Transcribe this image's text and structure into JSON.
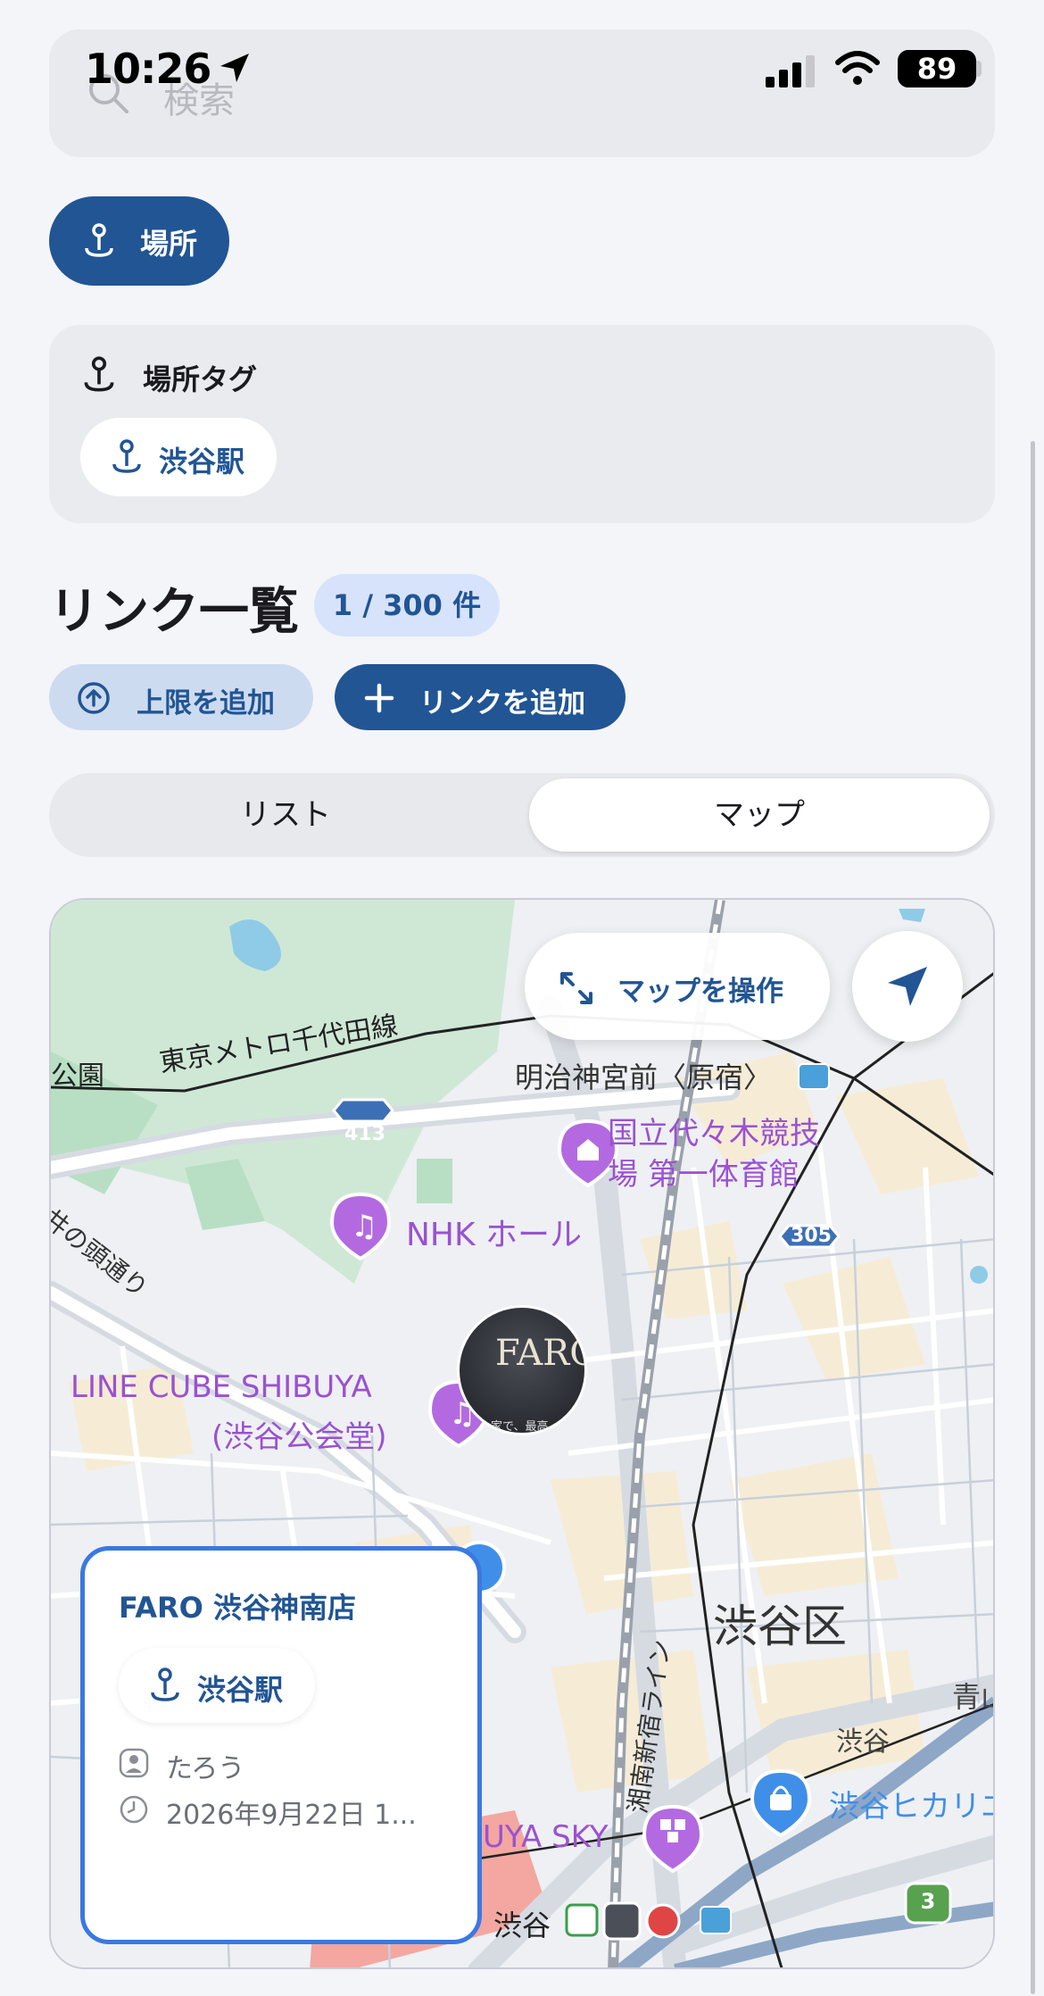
{
  "status_bar": {
    "time": "10:26",
    "battery": "89"
  },
  "search": {
    "placeholder": "検索"
  },
  "location_chip": {
    "label": "場所"
  },
  "tags_card": {
    "title": "場所タグ",
    "tag": "渋谷駅"
  },
  "links": {
    "title": "リンク一覧",
    "count": "1 / 300 件",
    "add_limit_label": "上限を追加",
    "add_link_label": "リンクを追加"
  },
  "segmented": {
    "list_label": "リスト",
    "map_label": "マップ",
    "selected": "マップ"
  },
  "map": {
    "operate_label": "マップを操作",
    "labels": {
      "park": "公園",
      "chiyoda_line": "東京メトロ千代田線",
      "route_413": "413",
      "route_305": "305",
      "ikenohata": "井の頭通り",
      "meiji_station": "明治神宮前〈原宿〉",
      "gymnasium_line1": "国立代々木競技",
      "gymnasium_line2": "場 第一体育館",
      "nhk_hall": "NHK ホール",
      "line_cube_line1": "LINE CUBE SHIBUYA",
      "line_cube_line2": "(渋谷公会堂)",
      "shibuya_ku": "渋谷区",
      "shonan_line": "湘南新宿ライン",
      "shibuya_small": "渋谷",
      "aoyama": "青山",
      "hikarie": "渋谷ヒカリエ",
      "shibuya_sky": "UYA SKY",
      "shibuya_station": "渋谷",
      "route_3": "3",
      "photo_text": "FARO",
      "photo_caption": "れ家で、最高"
    },
    "colors": {
      "park": "#cfe8d6",
      "water": "#8fcbe6",
      "road": "#ffffff",
      "music_pin": "#b36ae0",
      "place_pin": "#3f8fe8"
    }
  },
  "info_card": {
    "title": "FARO 渋谷神南店",
    "tag": "渋谷駅",
    "user": "たろう",
    "date": "2026年9月22日 1..."
  }
}
